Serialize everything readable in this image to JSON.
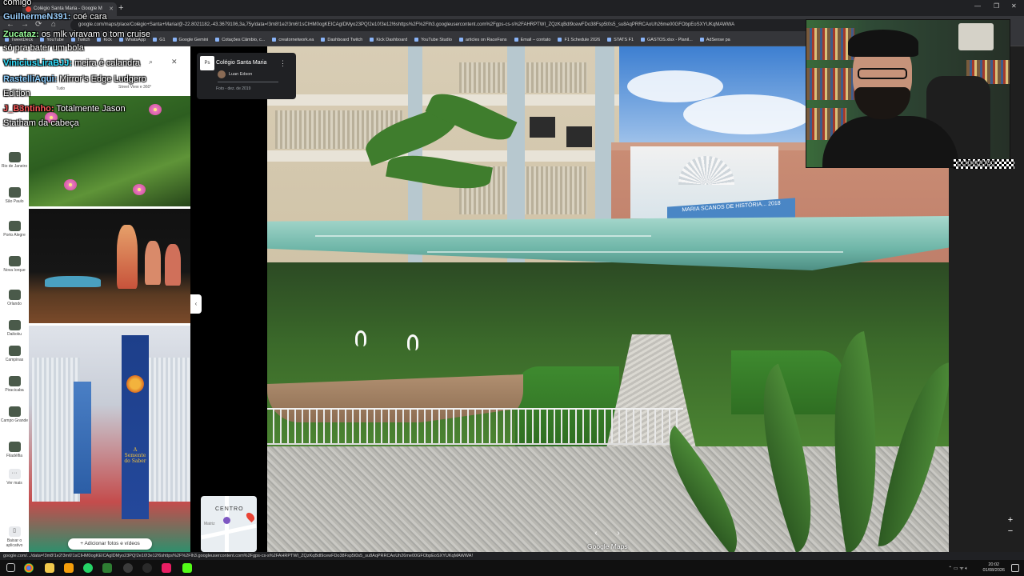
{
  "chat": [
    {
      "user": "",
      "text": "comigo",
      "user_color": "#ffffff"
    },
    {
      "user": "GuilhermeN391:",
      "text": "coé cara",
      "user_color": "#9bd0ff"
    },
    {
      "user": "Zucataz:",
      "text": "os mlk viravam o tom cruise",
      "user_color": "#9bff9b"
    },
    {
      "user": "",
      "text": "só pra bater um bola",
      "user_color": "#ffffff"
    },
    {
      "user": "ViniciusLiraBJJ:",
      "text": "meira é calandra",
      "user_color": "#33e0ff"
    },
    {
      "user": "RastelliAqui:",
      "text": "Mirror's Edge Ludgero",
      "user_color": "#8fd0ff"
    },
    {
      "user": "",
      "text": "Edition",
      "user_color": "#ffffff"
    },
    {
      "user": "J_B3ntinho:",
      "text": "Totalmente Jason",
      "user_color": "#ff5a5a"
    },
    {
      "user": "",
      "text": "Statham da cabeça",
      "user_color": "#ffffff"
    }
  ],
  "browser": {
    "tab_title": "Colégio Santa Maria - Google M",
    "url": "google.com/maps/place/Colégio+Santa+Maria/@-22.8021182,-43.3679106,3a,75y/data=!3m8!1e2!3m6!1sCIHM0ogKEICAgIDMyo23PQ!2e10!3e12!6shttps%2F%2Flh3.googleusercontent.com%2Fgps-cs-s%2FAHRPTWI_ZQzKqBdl9cewFDo38Fsp5t0s5_su8AqPRRCAoUh26me00GFObpEoSXYUKqMAWWA",
    "bookmarks": [
      "TweetDeck",
      "YouTube",
      "Twitch",
      "Kick",
      "WhatsApp",
      "G1",
      "Google Gemini",
      "Cotações Câmbio, c...",
      "creatornetwork.ea",
      "Dashboard Twitch",
      "Kick Dashboard",
      "YouTube Studio",
      "articles on RaceFans",
      "Email – contato",
      "F1 Schedule 2026",
      "STATS F1",
      "GASTOS.xlsx - Planil...",
      "AdSense pa"
    ]
  },
  "rail": [
    {
      "label": "Rio de Janeiro"
    },
    {
      "label": "São Paulo"
    },
    {
      "label": "Porto Alegre"
    },
    {
      "label": "Nova Iorque"
    },
    {
      "label": "Orlando"
    },
    {
      "label": "Daikoku"
    },
    {
      "label": "Campinas"
    },
    {
      "label": "Piracicaba"
    },
    {
      "label": "Campo Grande"
    },
    {
      "label": "Filadélfia"
    },
    {
      "label": "Ver mais"
    },
    {
      "label": "Baixar o aplicativo"
    }
  ],
  "photos_panel": {
    "tab_all": "Tudo",
    "tab_streetview": "Street View e 360°",
    "add_media": "Adicionar fotos e vídeos",
    "banner_text": "A Semente do Saber"
  },
  "title_card": {
    "thumb_label": "Ps",
    "place": "Colégio Santa Maria",
    "author": "Luan Edson",
    "date": "Foto - dez. de 2019"
  },
  "minimap": {
    "label": "CENTRO",
    "sublabel": "Matriz"
  },
  "scene": {
    "sign_text": "MARIA SCANOS DE HISTÓRIA... 2018",
    "watermark": "Google Maps"
  },
  "webcam": {
    "logo": "LUDGERO"
  },
  "status_url": "google.com/.../data=!3m8!1e2!3m6!1sCIHM0ogKEICAgIDMyo23PQ!2e10!3e12!6shttps%2F%2Flh3.googleusercontent.com%2Fgps-cs-s%2FAHRPTWI_ZQzKqBdl9cewFDo38Fsp5t0s5_su8AqPRRCAoUh26me00GFObpEoSXYUKqMAWWA!",
  "clock": {
    "time": "20:02",
    "date": "01/08/2026"
  }
}
